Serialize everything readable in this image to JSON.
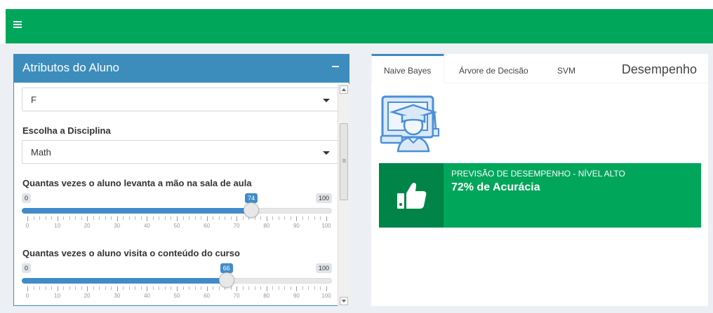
{
  "header": {
    "menu_icon": "hamburger-menu-icon",
    "color": "#00a65a"
  },
  "left_box": {
    "title": "Atributos do Aluno",
    "header_color": "#3c8dbc",
    "gender_select": {
      "value": "F"
    },
    "discipline": {
      "label": "Escolha a Disciplina",
      "value": "Math"
    },
    "slider_hands": {
      "label": "Quantas vezes o aluno levanta a mão na sala de aula",
      "min": "0",
      "max": "100",
      "value": 74,
      "value_label": "74",
      "tick_labels": [
        "0",
        "10",
        "20",
        "30",
        "40",
        "50",
        "60",
        "70",
        "80",
        "90",
        "100"
      ]
    },
    "slider_content": {
      "label": "Quantas vezes o aluno visita o conteúdo do curso",
      "min": "0",
      "max": "100",
      "value": 66,
      "value_label": "66",
      "tick_labels": [
        "0",
        "10",
        "20",
        "30",
        "40",
        "50",
        "60",
        "70",
        "80",
        "90",
        "100"
      ]
    }
  },
  "right_box": {
    "tabs": [
      {
        "label": "Naive Bayes",
        "active": true
      },
      {
        "label": "Árvore de Decisão",
        "active": false
      },
      {
        "label": "SVM",
        "active": false
      }
    ],
    "panel_title": "Desempenho",
    "student_icon": "graduate-computer-icon",
    "infobox": {
      "icon": "thumbs-up-icon",
      "caption": "PREVISÃO DE DESEMPENHO - NÍVEL ALTO",
      "value": "72% de Acurácia",
      "color": "#00a65a"
    }
  }
}
